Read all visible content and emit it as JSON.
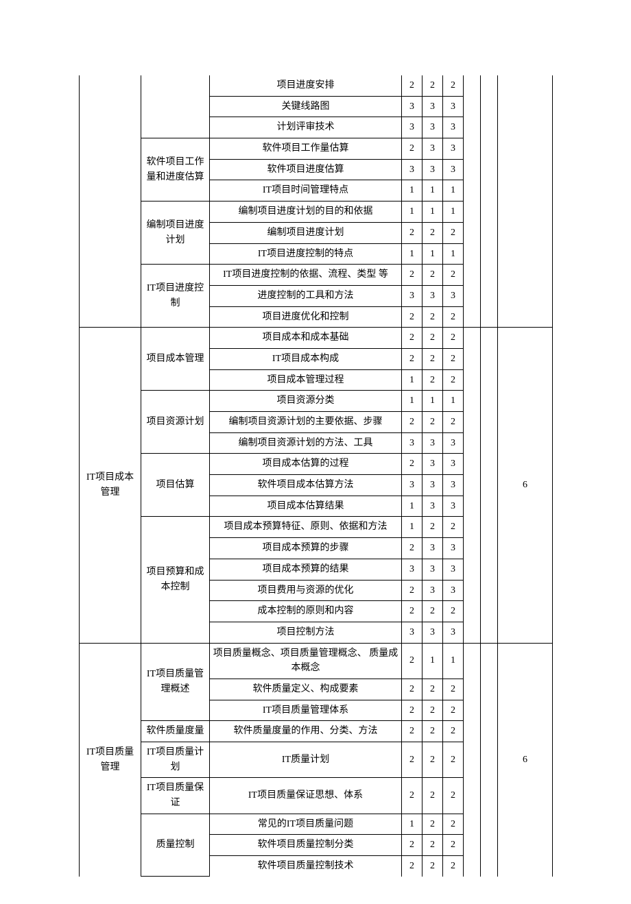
{
  "sections": [
    {
      "col1": "",
      "col9": "",
      "groups": [
        {
          "col2": "",
          "rows": [
            {
              "c3": "项目进度安排",
              "c4": "2",
              "c5": "2",
              "c6": "2"
            },
            {
              "c3": "关键线路图",
              "c4": "3",
              "c5": "3",
              "c6": "3"
            },
            {
              "c3": "计划评审技术",
              "c4": "3",
              "c5": "3",
              "c6": "3"
            }
          ]
        },
        {
          "col2": "软件项目工作量和进度估算",
          "rows": [
            {
              "c3": "软件项目工作量估算",
              "c4": "2",
              "c5": "3",
              "c6": "3"
            },
            {
              "c3": "软件项目进度估算",
              "c4": "3",
              "c5": "3",
              "c6": "3"
            },
            {
              "c3": "IT项目时间管理特点",
              "c4": "1",
              "c5": "1",
              "c6": "1"
            }
          ]
        },
        {
          "col2": "编制项目进度计划",
          "rows": [
            {
              "c3": "编制项目进度计划的目的和依据",
              "c4": "1",
              "c5": "1",
              "c6": "1"
            },
            {
              "c3": "编制项目进度计划",
              "c4": "2",
              "c5": "2",
              "c6": "2"
            },
            {
              "c3": "IT项目进度控制的特点",
              "c4": "1",
              "c5": "1",
              "c6": "1"
            }
          ]
        },
        {
          "col2": "IT项目进度控制",
          "rows": [
            {
              "c3": "IT项目进度控制的依据、流程、类型 等",
              "c4": "2",
              "c5": "2",
              "c6": "2"
            },
            {
              "c3": "进度控制的工具和方法",
              "c4": "3",
              "c5": "3",
              "c6": "3"
            },
            {
              "c3": "项目进度优化和控制",
              "c4": "2",
              "c5": "2",
              "c6": "2"
            }
          ]
        }
      ]
    },
    {
      "col1": "IT项目成本管理",
      "col9": "6",
      "groups": [
        {
          "col2": "项目成本管理",
          "rows": [
            {
              "c3": "项目成本和成本基础",
              "c4": "2",
              "c5": "2",
              "c6": "2"
            },
            {
              "c3": "IT项目成本构成",
              "c4": "2",
              "c5": "2",
              "c6": "2"
            },
            {
              "c3": "项目成本管理过程",
              "c4": "1",
              "c5": "2",
              "c6": "2"
            }
          ]
        },
        {
          "col2": "项目资源计划",
          "rows": [
            {
              "c3": "项目资源分类",
              "c4": "1",
              "c5": "1",
              "c6": "1"
            },
            {
              "c3": "编制项目资源计划的主要依据、步骤",
              "c4": "2",
              "c5": "2",
              "c6": "2"
            },
            {
              "c3": "编制项目资源计划的方法、工具",
              "c4": "3",
              "c5": "3",
              "c6": "3"
            }
          ]
        },
        {
          "col2": "项目估算",
          "rows": [
            {
              "c3": "项目成本估算的过程",
              "c4": "2",
              "c5": "3",
              "c6": "3"
            },
            {
              "c3": "软件项目成本估算方法",
              "c4": "3",
              "c5": "3",
              "c6": "3"
            },
            {
              "c3": "项目成本估算结果",
              "c4": "1",
              "c5": "3",
              "c6": "3"
            }
          ]
        },
        {
          "col2": "项目预算和成本控制",
          "rows": [
            {
              "c3": "项目成本预算特征、原则、依据和方法",
              "c4": "1",
              "c5": "2",
              "c6": "2"
            },
            {
              "c3": "项目成本预算的步骤",
              "c4": "2",
              "c5": "3",
              "c6": "3"
            },
            {
              "c3": "项目成本预算的结果",
              "c4": "3",
              "c5": "3",
              "c6": "3"
            },
            {
              "c3": "项目费用与资源的优化",
              "c4": "2",
              "c5": "3",
              "c6": "3"
            },
            {
              "c3": "成本控制的原则和内容",
              "c4": "2",
              "c5": "2",
              "c6": "2"
            },
            {
              "c3": "项目控制方法",
              "c4": "3",
              "c5": "3",
              "c6": "3"
            }
          ]
        }
      ]
    },
    {
      "col1": "IT项目质量管理",
      "col9": "6",
      "groups": [
        {
          "col2": "IT项目质量管理概述",
          "rows": [
            {
              "c3": "项目质量概念、项目质量管理概念、 质量成本概念",
              "c4": "2",
              "c5": "1",
              "c6": "1"
            },
            {
              "c3": "软件质量定义、构成要素",
              "c4": "2",
              "c5": "2",
              "c6": "2"
            },
            {
              "c3": "IT项目质量管理体系",
              "c4": "2",
              "c5": "2",
              "c6": "2"
            }
          ]
        },
        {
          "col2": "软件质量度量",
          "rows": [
            {
              "c3": "软件质量度量的作用、分类、方法",
              "c4": "2",
              "c5": "2",
              "c6": "2"
            }
          ]
        },
        {
          "col2": "IT项目质量计划",
          "rows": [
            {
              "c3": "IT质量计划",
              "c4": "2",
              "c5": "2",
              "c6": "2"
            }
          ]
        },
        {
          "col2": "IT项目质量保证",
          "rows": [
            {
              "c3": "IT项目质量保证思想、体系",
              "c4": "2",
              "c5": "2",
              "c6": "2"
            }
          ]
        },
        {
          "col2": "质量控制",
          "rows": [
            {
              "c3": "常见的IT项目质量问题",
              "c4": "1",
              "c5": "2",
              "c6": "2"
            },
            {
              "c3": "软件项目质量控制分类",
              "c4": "2",
              "c5": "2",
              "c6": "2"
            },
            {
              "c3": "软件项目质量控制技术",
              "c4": "2",
              "c5": "2",
              "c6": "2"
            }
          ]
        }
      ]
    }
  ]
}
